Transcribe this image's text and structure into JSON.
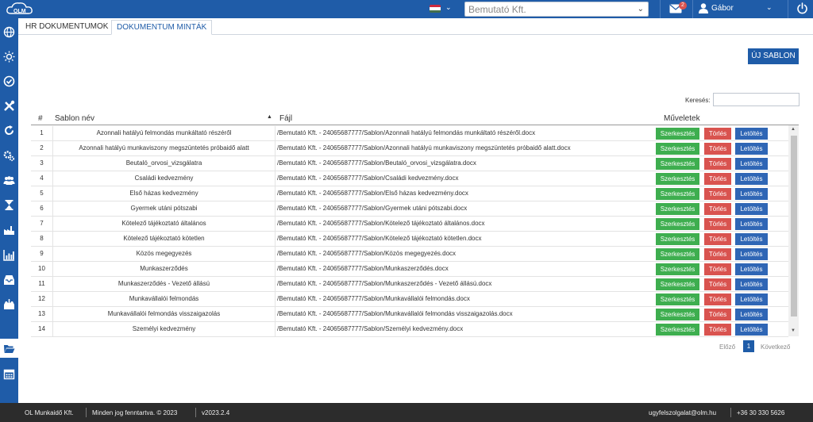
{
  "header": {
    "logo_text": "OLM",
    "company": "Bemutató Kft.",
    "mail_count": "2",
    "user_name": "Gábor"
  },
  "sidebar": {
    "icons": [
      "globe-icon",
      "sun-icon",
      "check-circle-icon",
      "tools-icon",
      "rotate-icon",
      "gears-icon",
      "users-icon",
      "hourglass-icon",
      "factory-icon",
      "chart-icon",
      "inbox-icon",
      "inbox-download-icon",
      "folder-open-icon",
      "calendar-icon"
    ]
  },
  "tabs": [
    {
      "label": "HR DOKUMENTUMOK",
      "active": false
    },
    {
      "label": "DOKUMENTUM MINTÁK",
      "active": true
    }
  ],
  "toolbar": {
    "new_template_label": "ÚJ SABLON"
  },
  "search": {
    "label": "Keresés:",
    "value": ""
  },
  "table": {
    "headers": {
      "num": "#",
      "name": "Sablon név",
      "file": "Fájl",
      "actions": "Műveletek"
    },
    "action_labels": {
      "edit": "Szerkesztés",
      "delete": "Törlés",
      "download": "Letöltés"
    },
    "rows": [
      {
        "num": "1",
        "name": "Azonnali hatályú felmondás munkáltató részéről",
        "file": "/Bemutató Kft. - 24065687777/Sablon/Azonnali hatályú felmondás munkáltató részéről.docx"
      },
      {
        "num": "2",
        "name": "Azonnali hatályú munkaviszony megszüntetés próbaidő alatt",
        "file": "/Bemutató Kft. - 24065687777/Sablon/Azonnali hatályú munkaviszony megszüntetés próbaidő alatt.docx"
      },
      {
        "num": "3",
        "name": "Beutaló_orvosi_vizsgálatra",
        "file": "/Bemutató Kft. - 24065687777/Sablon/Beutaló_orvosi_vizsgálatra.docx"
      },
      {
        "num": "4",
        "name": "Családi kedvezmény",
        "file": "/Bemutató Kft. - 24065687777/Sablon/Családi kedvezmény.docx"
      },
      {
        "num": "5",
        "name": "Első házas kedvezmény",
        "file": "/Bemutató Kft. - 24065687777/Sablon/Első házas kedvezmény.docx"
      },
      {
        "num": "6",
        "name": "Gyermek utáni pótszabi",
        "file": "/Bemutató Kft. - 24065687777/Sablon/Gyermek utáni pótszabi.docx"
      },
      {
        "num": "7",
        "name": "Kötelező tájékoztató általános",
        "file": "/Bemutató Kft. - 24065687777/Sablon/Kötelező tájékoztató általános.docx"
      },
      {
        "num": "8",
        "name": "Kötelező tájékoztató kötetlen",
        "file": "/Bemutató Kft. - 24065687777/Sablon/Kötelező tájékoztató kötetlen.docx"
      },
      {
        "num": "9",
        "name": "Közös megegyezés",
        "file": "/Bemutató Kft. - 24065687777/Sablon/Közös megegyezés.docx"
      },
      {
        "num": "10",
        "name": "Munkaszerződés",
        "file": "/Bemutató Kft. - 24065687777/Sablon/Munkaszerződés.docx"
      },
      {
        "num": "11",
        "name": "Munkaszerződés - Vezető állású",
        "file": "/Bemutató Kft. - 24065687777/Sablon/Munkaszerződés - Vezető állású.docx"
      },
      {
        "num": "12",
        "name": "Munkavállalói felmondás",
        "file": "/Bemutató Kft. - 24065687777/Sablon/Munkavállalói felmondás.docx"
      },
      {
        "num": "13",
        "name": "Munkavállalói felmondás visszaigazolás",
        "file": "/Bemutató Kft. - 24065687777/Sablon/Munkavállalói felmondás visszaigazolás.docx"
      },
      {
        "num": "14",
        "name": "Személyi kedvezmény",
        "file": "/Bemutató Kft. - 24065687777/Sablon/Személyi kedvezmény.docx"
      }
    ]
  },
  "pagination": {
    "prev": "Előző",
    "current": "1",
    "next": "Következő"
  },
  "footer": {
    "company": "OL Munkaidő Kft.",
    "rights": "Minden jog fenntartva. © 2023",
    "version": "v2023.2.4",
    "email": "ugyfelszolgalat@olm.hu",
    "phone": "+36 30 330 5626"
  },
  "colors": {
    "brand": "#1f5ca8",
    "edit": "#3eae4f",
    "delete": "#d9534f",
    "download": "#2f66b5",
    "footer": "#2c2c2c"
  }
}
